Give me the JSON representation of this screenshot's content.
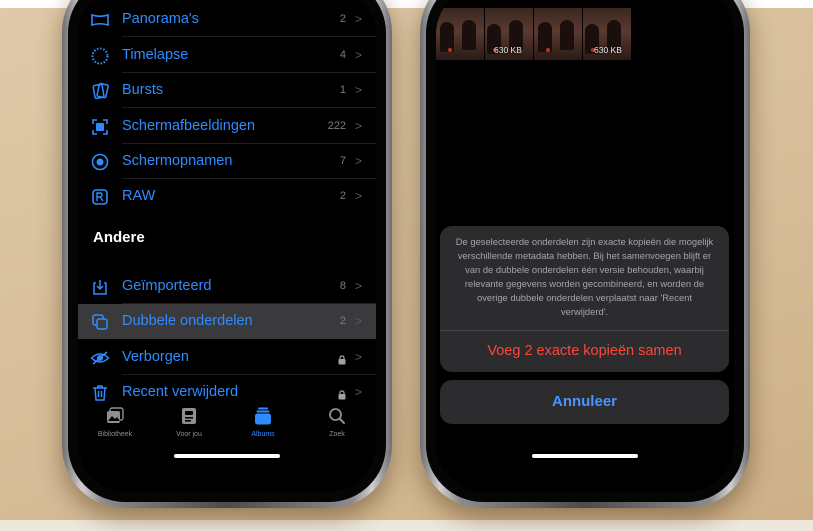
{
  "left_phone": {
    "media_types": [
      {
        "label": "Panorama's",
        "count": "2",
        "icon": "panorama-icon"
      },
      {
        "label": "Timelapse",
        "count": "4",
        "icon": "timelapse-icon"
      },
      {
        "label": "Bursts",
        "count": "1",
        "icon": "bursts-icon"
      },
      {
        "label": "Schermafbeeldingen",
        "count": "222",
        "icon": "screenshot-icon"
      },
      {
        "label": "Schermopnamen",
        "count": "7",
        "icon": "screen-recording-icon"
      },
      {
        "label": "RAW",
        "count": "2",
        "icon": "raw-icon"
      }
    ],
    "other_section_title": "Andere",
    "other_items": [
      {
        "label": "Geïmporteerd",
        "count": "8",
        "icon": "import-icon"
      },
      {
        "label": "Dubbele onderdelen",
        "count": "2",
        "icon": "duplicates-icon",
        "selected": true
      },
      {
        "label": "Verborgen",
        "icon": "hidden-eye-icon",
        "locked": true
      },
      {
        "label": "Recent verwijderd",
        "icon": "trash-icon",
        "locked": true
      }
    ],
    "tabs": [
      {
        "label": "Bibliotheek",
        "icon": "photo-library-icon",
        "active": false
      },
      {
        "label": "Voor jou",
        "icon": "for-you-icon",
        "active": false
      },
      {
        "label": "Albums",
        "icon": "albums-icon",
        "active": true
      },
      {
        "label": "Zoek",
        "icon": "search-icon",
        "active": false
      }
    ]
  },
  "right_phone": {
    "thumbnails": [
      {
        "size": "630 KB"
      },
      {
        "size": "630 KB"
      }
    ],
    "sheet": {
      "message": "De geselecteerde onderdelen zijn exacte kopieën die mogelijk verschillende metadata hebben. Bij het samenvoegen blijft er van de dubbele onderdelen één versie behouden, waarbij relevante gegevens worden gecombineerd, en worden de overige dubbele onderdelen verplaatst naar 'Recent verwijderd'.",
      "action_label": "Voeg 2 exacte kopieën samen",
      "cancel_label": "Annuleer"
    }
  },
  "colors": {
    "accent": "#2f8cff",
    "destructive": "#ff453a",
    "background": "#d9c2a0"
  }
}
